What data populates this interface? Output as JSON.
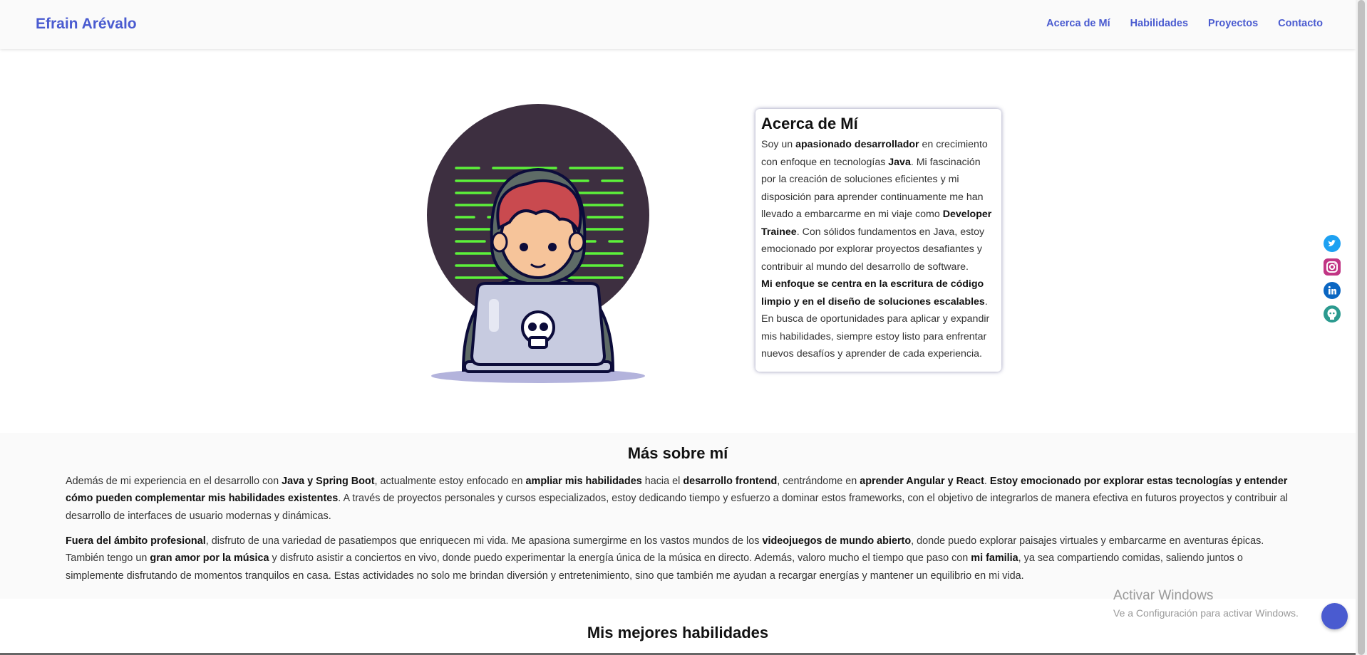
{
  "navbar": {
    "brand": "Efrain Arévalo",
    "links": [
      "Acerca de Mí",
      "Habilidades",
      "Proyectos",
      "Contacto"
    ]
  },
  "about": {
    "title": "Acerca de Mí",
    "p1": [
      {
        "t": "Soy un ",
        "b": false
      },
      {
        "t": "apasionado desarrollador",
        "b": true
      },
      {
        "t": " en crecimiento con enfoque en tecnologías ",
        "b": false
      },
      {
        "t": "Java",
        "b": true
      },
      {
        "t": ". Mi fascinación por la creación de soluciones eficientes y mi disposición para aprender continuamente me han llevado a embarcarme en mi viaje como ",
        "b": false
      },
      {
        "t": "Developer Trainee",
        "b": true
      },
      {
        "t": ". Con sólidos fundamentos en Java, estoy emocionado por explorar proyectos desafiantes y contribuir al mundo del desarrollo de software.",
        "b": false
      }
    ],
    "p2": [
      {
        "t": "Mi enfoque se centra en la escritura de código limpio y en el diseño de soluciones escalables",
        "b": true
      },
      {
        "t": ". En busca de oportunidades para aplicar y expandir mis habilidades, siempre estoy listo para enfrentar nuevos desafíos y aprender de cada experiencia.",
        "b": false
      }
    ]
  },
  "social": {
    "icons": [
      "twitter-icon",
      "instagram-icon",
      "linkedin-icon",
      "github-icon"
    ],
    "colors": {
      "twitter": "#1da1f2",
      "instagram": "#c13584",
      "linkedin": "#0a66c2",
      "github": "#2b9a8f"
    }
  },
  "more": {
    "title": "Más sobre mí",
    "p1": [
      {
        "t": "Además de mi experiencia en el desarrollo con ",
        "b": false
      },
      {
        "t": "Java y Spring Boot",
        "b": true
      },
      {
        "t": ", actualmente estoy enfocado en ",
        "b": false
      },
      {
        "t": "ampliar mis habilidades",
        "b": true
      },
      {
        "t": " hacia el ",
        "b": false
      },
      {
        "t": "desarrollo frontend",
        "b": true
      },
      {
        "t": ", centrándome en ",
        "b": false
      },
      {
        "t": "aprender Angular y React",
        "b": true
      },
      {
        "t": ". ",
        "b": false
      },
      {
        "t": "Estoy emocionado por explorar estas tecnologías y entender cómo pueden complementar mis habilidades existentes",
        "b": true
      },
      {
        "t": ". A través de proyectos personales y cursos especializados, estoy dedicando tiempo y esfuerzo a dominar estos frameworks, con el objetivo de integrarlos de manera efectiva en futuros proyectos y contribuir al desarrollo de interfaces de usuario modernas y dinámicas.",
        "b": false
      }
    ],
    "p2": [
      {
        "t": "Fuera del ámbito profesional",
        "b": true
      },
      {
        "t": ", disfruto de una variedad de pasatiempos que enriquecen mi vida. Me apasiona sumergirme en los vastos mundos de los ",
        "b": false
      },
      {
        "t": "videojuegos de mundo abierto",
        "b": true
      },
      {
        "t": ", donde puedo explorar paisajes virtuales y embarcarme en aventuras épicas. También tengo un ",
        "b": false
      },
      {
        "t": "gran amor por la música",
        "b": true
      },
      {
        "t": " y disfruto asistir a conciertos en vivo, donde puedo experimentar la energía única de la música en directo. Además, valoro mucho el tiempo que paso con ",
        "b": false
      },
      {
        "t": "mi familia",
        "b": true
      },
      {
        "t": ", ya sea compartiendo comidas, saliendo juntos o simplemente disfrutando de momentos tranquilos en casa. Estas actividades no solo me brindan diversión y entretenimiento, sino que también me ayudan a recargar energías y mantener un equilibrio en mi vida.",
        "b": false
      }
    ]
  },
  "skills": {
    "title": "Mis mejores habilidades"
  },
  "watermark": {
    "title": "Activar Windows",
    "subtitle": "Ve a Configuración para activar Windows."
  },
  "theme": {
    "accent": "#4a5bd0",
    "code_green": "#5df13a",
    "circle": "#3d2f40"
  }
}
